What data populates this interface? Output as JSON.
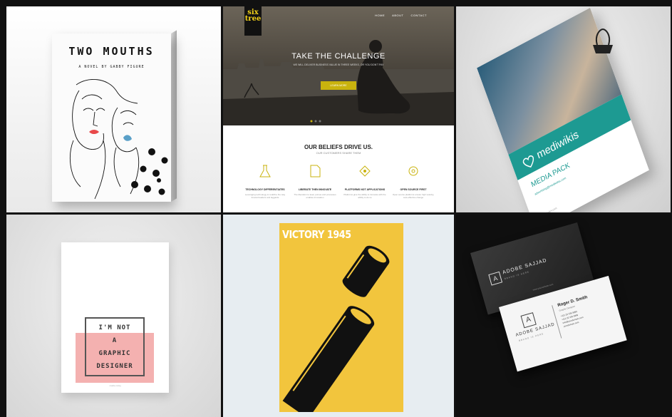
{
  "tile1": {
    "title": "TWO MOUTHS",
    "subtitle": "A NOVEL BY GABBY FIGURE"
  },
  "tile2": {
    "logo": "six tree",
    "nav": [
      "HOME",
      "ABOUT",
      "CONTACT"
    ],
    "hero_title": "TAKE THE CHALLENGE",
    "hero_text": "WE WILL DELIVER BUSINESS VALUE IN THREE WEEKS, OR YOU DON'T PAY",
    "hero_button": "LEARN MORE",
    "section_title": "OUR BELIEFS DRIVE US.",
    "section_subtitle": "OUR CUSTOMERS SHARE THEM",
    "features": [
      {
        "title": "TECHNOLOGY DIFFERENTIATES",
        "text": "Leveraging technology to redefine the way forward leaders and laggards"
      },
      {
        "title": "LIBERATE THEN INNOVATE",
        "text": "The liberation to lead, pursue and processes enables innovation"
      },
      {
        "title": "PLATFORMS NOT APPLICATIONS",
        "text": "Platforms give the ability to innovate with the ability to do so"
      },
      {
        "title": "OPEN SOURCE FIRST",
        "text": "Open source platforms ensure high velocity, cost-effective change"
      }
    ]
  },
  "tile3": {
    "logo": "mediwikis",
    "title": "MEDIA PACK",
    "email": "advertising@mediwikis.com",
    "url": "mediwikis.com"
  },
  "tile4": {
    "lines": [
      "I'M NOT",
      "A",
      "GRAPHIC",
      "DESIGNER"
    ],
    "footer": "creative Living"
  },
  "tile5": {
    "title": "VICTORY 1945"
  },
  "tile6": {
    "dark_card": {
      "logo_letter": "A",
      "brand": "ADOBE SAJJAD",
      "tagline": "BRAND IS HERE",
      "web": "www.yourwebsite.com"
    },
    "light_card": {
      "logo_letter": "A",
      "brand": "ADOBE SAJJAD",
      "tagline": "BRAND IS HERE",
      "name": "Roger D. Smith",
      "role": "Graphic Designer",
      "info": [
        "+111 22 336 9999",
        "+111 22 336 9999",
        "info@yourdomain.com",
        "yourdomain.com"
      ]
    }
  },
  "colors": {
    "gutter": "#111111",
    "yellow": "#f2c53d",
    "teal": "#1d9a92",
    "pink": "#f4b1b0"
  }
}
